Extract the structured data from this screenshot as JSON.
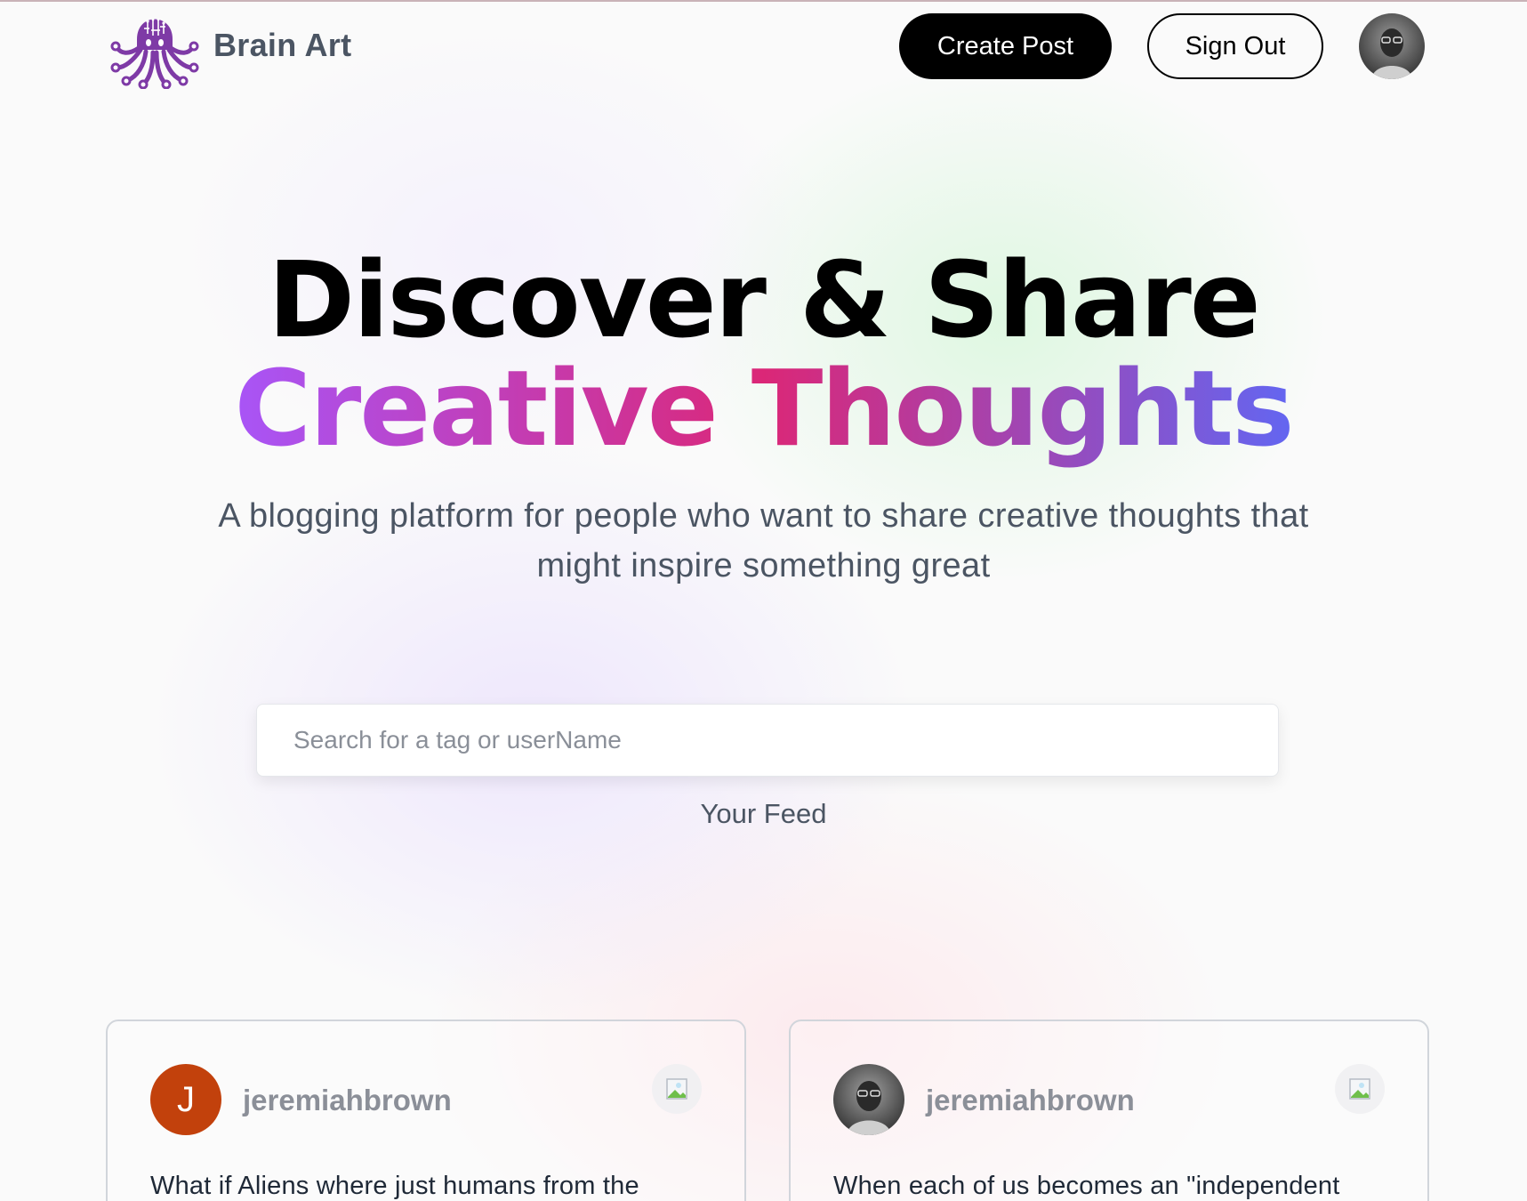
{
  "nav": {
    "brand": "Brain Art",
    "create_post_label": "Create Post",
    "sign_out_label": "Sign Out",
    "logo_icon": "octopus-brain-logo",
    "avatar_icon": "user-avatar-photo"
  },
  "hero": {
    "line1": "Discover & Share",
    "line2": "Creative Thoughts",
    "subtitle": "A blogging platform for people who want to share creative thoughts that might inspire something great"
  },
  "search": {
    "placeholder": "Search for a tag or userName",
    "value": ""
  },
  "feed": {
    "label": "Your Feed",
    "posts": [
      {
        "username": "jeremiahbrown",
        "avatar_letter": "J",
        "text": "What if Aliens where just humans from the",
        "copy_icon": "copy-icon-broken-image"
      },
      {
        "username": "jeremiahbrown",
        "avatar_letter": "",
        "text": "When each of us becomes an \"independent",
        "copy_icon": "copy-icon-broken-image"
      }
    ]
  },
  "colors": {
    "brand_purple": "#7e3aa6",
    "gradient": [
      "#a855f7",
      "#db2777",
      "#6366f1"
    ],
    "avatar_orange": "#c2410c"
  }
}
